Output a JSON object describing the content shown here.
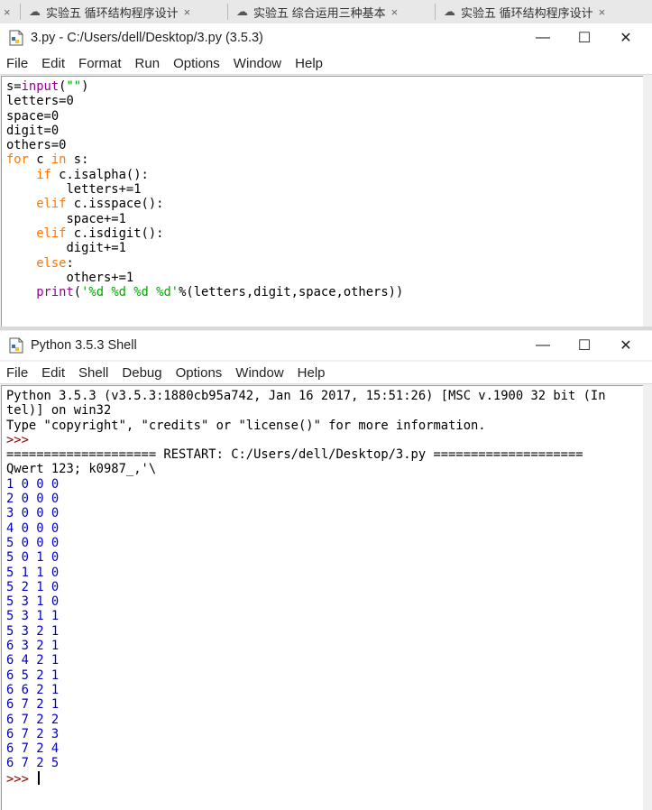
{
  "browser_tabs": [
    {
      "label": "实验五 循环结构程序设计"
    },
    {
      "label": "实验五 综合运用三种基本"
    },
    {
      "label": "实验五 循环结构程序设计"
    }
  ],
  "editor_window": {
    "title": "3.py - C:/Users/dell/Desktop/3.py (3.5.3)",
    "menu": [
      "File",
      "Edit",
      "Format",
      "Run",
      "Options",
      "Window",
      "Help"
    ]
  },
  "editor_code": [
    {
      "kind": "code",
      "segments": [
        {
          "t": "s=",
          "c": ""
        },
        {
          "t": "input",
          "c": "bi"
        },
        {
          "t": "(",
          "c": ""
        },
        {
          "t": "\"\"",
          "c": "str"
        },
        {
          "t": ")",
          "c": ""
        }
      ]
    },
    {
      "kind": "code",
      "segments": [
        {
          "t": "letters=0",
          "c": ""
        }
      ]
    },
    {
      "kind": "code",
      "segments": [
        {
          "t": "space=0",
          "c": ""
        }
      ]
    },
    {
      "kind": "code",
      "segments": [
        {
          "t": "digit=0",
          "c": ""
        }
      ]
    },
    {
      "kind": "code",
      "segments": [
        {
          "t": "others=0",
          "c": ""
        }
      ]
    },
    {
      "kind": "code",
      "segments": [
        {
          "t": "for",
          "c": "kw"
        },
        {
          "t": " c ",
          "c": ""
        },
        {
          "t": "in",
          "c": "kw"
        },
        {
          "t": " s:",
          "c": ""
        }
      ]
    },
    {
      "kind": "code",
      "segments": [
        {
          "t": "    ",
          "c": ""
        },
        {
          "t": "if",
          "c": "kw"
        },
        {
          "t": " c.isalpha():",
          "c": ""
        }
      ]
    },
    {
      "kind": "code",
      "segments": [
        {
          "t": "        letters+=1",
          "c": ""
        }
      ]
    },
    {
      "kind": "code",
      "segments": [
        {
          "t": "    ",
          "c": ""
        },
        {
          "t": "elif",
          "c": "kw"
        },
        {
          "t": " c.isspace():",
          "c": ""
        }
      ]
    },
    {
      "kind": "code",
      "segments": [
        {
          "t": "        space+=1",
          "c": ""
        }
      ]
    },
    {
      "kind": "code",
      "segments": [
        {
          "t": "    ",
          "c": ""
        },
        {
          "t": "elif",
          "c": "kw"
        },
        {
          "t": " c.isdigit():",
          "c": ""
        }
      ]
    },
    {
      "kind": "code",
      "segments": [
        {
          "t": "        digit+=1",
          "c": ""
        }
      ]
    },
    {
      "kind": "code",
      "segments": [
        {
          "t": "    ",
          "c": ""
        },
        {
          "t": "else",
          "c": "kw"
        },
        {
          "t": ":",
          "c": ""
        }
      ]
    },
    {
      "kind": "code",
      "segments": [
        {
          "t": "        others+=1",
          "c": ""
        }
      ]
    },
    {
      "kind": "code",
      "segments": [
        {
          "t": "    ",
          "c": ""
        },
        {
          "t": "print",
          "c": "bi"
        },
        {
          "t": "(",
          "c": ""
        },
        {
          "t": "'%d %d %d %d'",
          "c": "str"
        },
        {
          "t": "%(letters,digit,space,others))",
          "c": ""
        }
      ]
    }
  ],
  "shell_window": {
    "title": "Python 3.5.3 Shell",
    "menu": [
      "File",
      "Edit",
      "Shell",
      "Debug",
      "Options",
      "Window",
      "Help"
    ]
  },
  "shell_lines": [
    {
      "t": "Python 3.5.3 (v3.5.3:1880cb95a742, Jan 16 2017, 15:51:26) [MSC v.1900 32 bit (In",
      "c": ""
    },
    {
      "t": "tel)] on win32",
      "c": ""
    },
    {
      "t": "Type \"copyright\", \"credits\" or \"license()\" for more information.",
      "c": ""
    },
    {
      "t": ">>> ",
      "c": "prompt"
    },
    {
      "t": "==================== RESTART: C:/Users/dell/Desktop/3.py ====================",
      "c": ""
    },
    {
      "t": "Qwert 123; k0987_,'\\",
      "c": ""
    },
    {
      "t": "1 0 0 0",
      "c": "out"
    },
    {
      "t": "2 0 0 0",
      "c": "out"
    },
    {
      "t": "3 0 0 0",
      "c": "out"
    },
    {
      "t": "4 0 0 0",
      "c": "out"
    },
    {
      "t": "5 0 0 0",
      "c": "out"
    },
    {
      "t": "5 0 1 0",
      "c": "out"
    },
    {
      "t": "5 1 1 0",
      "c": "out"
    },
    {
      "t": "5 2 1 0",
      "c": "out"
    },
    {
      "t": "5 3 1 0",
      "c": "out"
    },
    {
      "t": "5 3 1 1",
      "c": "out"
    },
    {
      "t": "5 3 2 1",
      "c": "out"
    },
    {
      "t": "6 3 2 1",
      "c": "out"
    },
    {
      "t": "6 4 2 1",
      "c": "out"
    },
    {
      "t": "6 5 2 1",
      "c": "out"
    },
    {
      "t": "6 6 2 1",
      "c": "out"
    },
    {
      "t": "6 7 2 1",
      "c": "out"
    },
    {
      "t": "6 7 2 2",
      "c": "out"
    },
    {
      "t": "6 7 2 3",
      "c": "out"
    },
    {
      "t": "6 7 2 4",
      "c": "out"
    },
    {
      "t": "6 7 2 5",
      "c": "out"
    },
    {
      "t": ">>> ",
      "c": "prompt",
      "cursor": true
    }
  ],
  "colors": {
    "keyword": "#ff7700",
    "builtin": "#900090",
    "string": "#00aa00",
    "output": "#0000c0",
    "prompt": "#800000"
  }
}
